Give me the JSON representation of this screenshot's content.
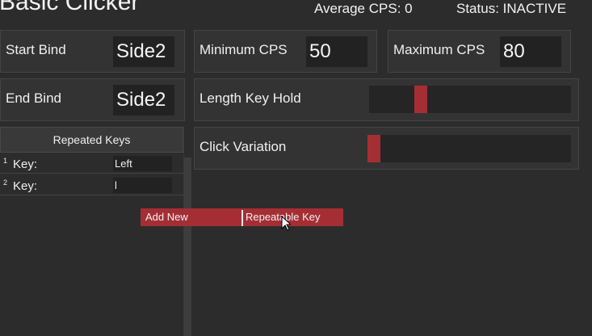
{
  "header": {
    "title": "Basic Clicker",
    "average_cps": "Average CPS: 0",
    "status": "Status: INACTIVE"
  },
  "binds": {
    "start_label": "Start Bind",
    "start_value": "Side2",
    "end_label": "End Bind",
    "end_value": "Side2"
  },
  "cps": {
    "min_label": "Minimum CPS",
    "min_value": "50",
    "max_label": "Maximum CPS",
    "max_value": "80"
  },
  "sliders": {
    "length_key_hold_label": "Length Key Hold",
    "length_key_hold_level": 0.24,
    "click_variation_label": "Click Variation",
    "click_variation_level": 0.0
  },
  "repeated_keys": {
    "title": "Repeated Keys",
    "rows": [
      {
        "index": "1",
        "label": "Key:",
        "value": "Left"
      },
      {
        "index": "2",
        "label": "Key:",
        "value": "l"
      }
    ]
  },
  "context_menu": {
    "left_text": "Add New",
    "right_text": "Repeatable Key"
  },
  "colors": {
    "background": "#2d2c2c",
    "panel": "#343333",
    "field": "#232222",
    "accent": "#a52e35",
    "text": "#f0f0f0"
  },
  "icons": {
    "cursor": "arrow-cursor-icon"
  }
}
